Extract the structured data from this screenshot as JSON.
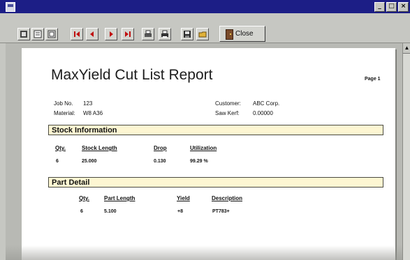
{
  "window": {
    "controls": {
      "minimize": "_",
      "maximize": "□",
      "close": "×"
    }
  },
  "toolbar": {
    "buttons": [
      {
        "name": "view-one-page-icon"
      },
      {
        "name": "view-two-pages-icon"
      },
      {
        "name": "zoom-icon"
      },
      {
        "name": "first-page-icon"
      },
      {
        "name": "previous-page-icon"
      },
      {
        "name": "next-page-icon"
      },
      {
        "name": "last-page-icon"
      },
      {
        "name": "print-setup-icon"
      },
      {
        "name": "print-icon"
      },
      {
        "name": "save-icon"
      },
      {
        "name": "open-icon"
      }
    ],
    "close_label": "Close"
  },
  "report": {
    "title": "MaxYield Cut List Report",
    "page": "Page 1",
    "job_label": "Job No.",
    "job_value": "123",
    "material_label": "Material:",
    "material_value": "W8 A36",
    "customer_label": "Customer:",
    "customer_value": "ABC Corp.",
    "kerf_label": "Saw Kerf:",
    "kerf_value": "0.00000",
    "stock": {
      "title": "Stock Information",
      "headers": [
        "Qty.",
        "Stock Length",
        "Drop",
        "Utilization"
      ],
      "row": [
        "6",
        "25.000",
        "0.130",
        "99.29 %"
      ]
    },
    "parts": {
      "title": "Part Detail",
      "headers": [
        "Qty.",
        "Part Length",
        "Yield",
        "Description"
      ],
      "row": [
        "6",
        "5.100",
        "+8",
        "PT783+"
      ]
    }
  },
  "colors": {
    "title_bar": "#1c1e86",
    "band_fill": "#fdf6d2",
    "chrome": "#c6c7c2"
  }
}
